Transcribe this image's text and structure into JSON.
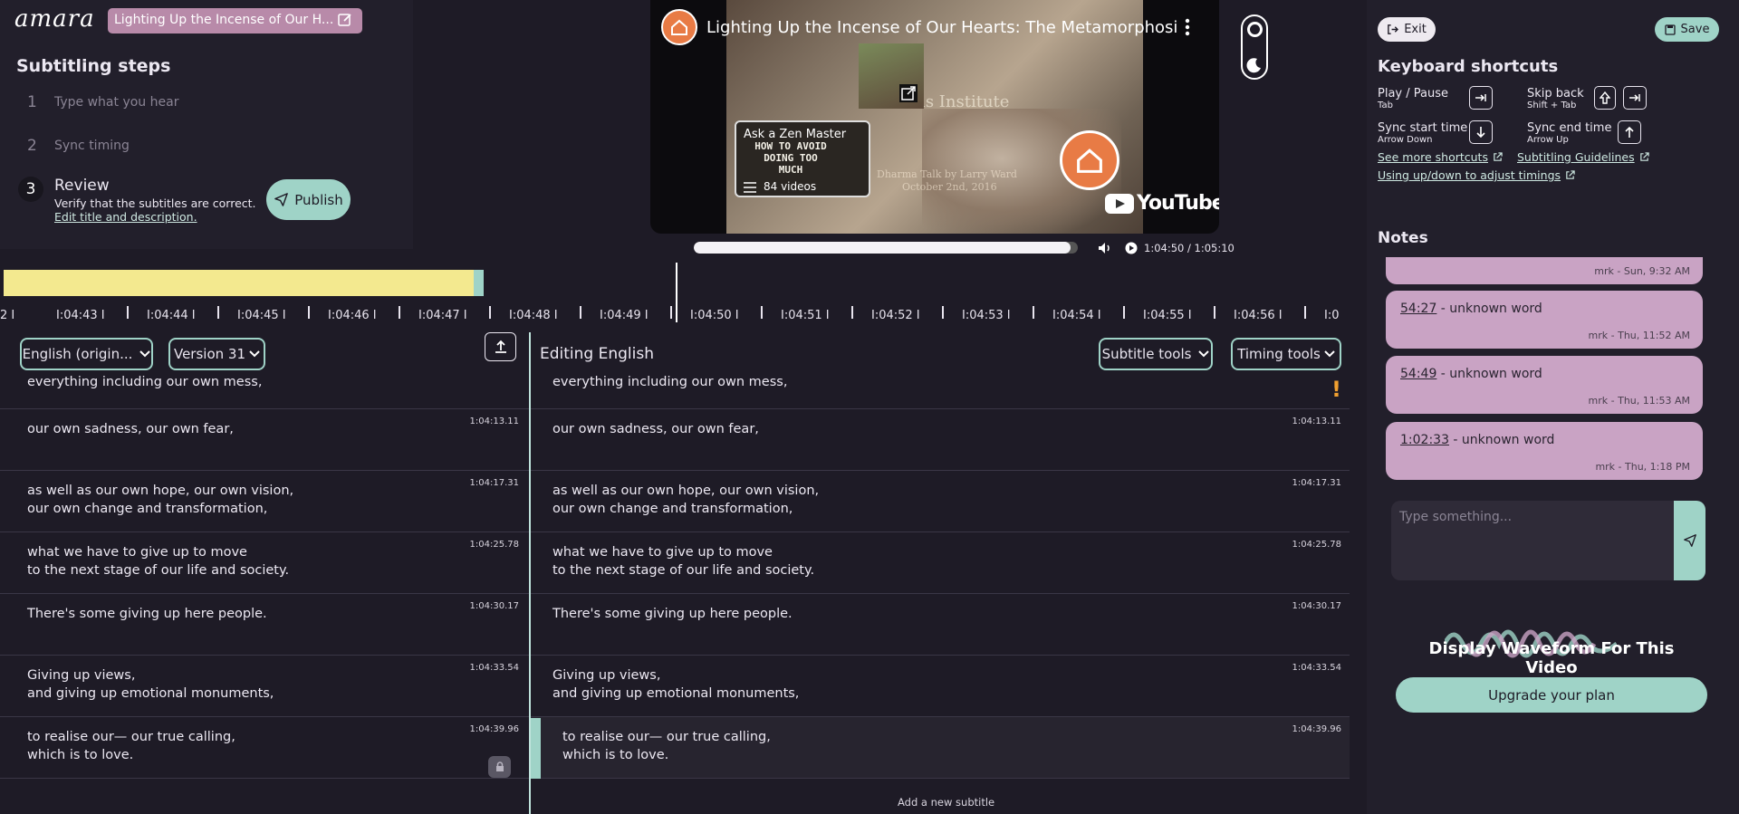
{
  "brand": {
    "logo": "amara"
  },
  "header": {
    "video_title": "Lighting Up the Incense of Our H..."
  },
  "steps": {
    "title": "Subtitling steps",
    "items": [
      {
        "num": "1",
        "label": "Type what you hear"
      },
      {
        "num": "2",
        "label": "Sync timing"
      },
      {
        "num": "3",
        "label": "Review",
        "desc": "Verify that the subtitles are correct.",
        "link": "Edit title and description."
      }
    ],
    "publish_label": "Publish"
  },
  "video": {
    "title": "Lighting Up the Incense of Our Hearts: The Metamorphosis of...",
    "card_title": "Ask a Zen Master",
    "card_thumb_text": "HOW TO AVOID DOING TOO MUCH",
    "card_count": "84 videos",
    "bg_text1": "tus Institute",
    "bg_text2": "Dharma Talk by Larry Ward",
    "bg_text3": "October 2nd, 2016",
    "youtube_label": "YouTube",
    "time": "1:04:50 / 1:05:10",
    "progress": 0.98
  },
  "timeline": {
    "ticks": [
      "2 I",
      "I:04:43 I",
      "I:04:44 I",
      "I:04:45 I",
      "I:04:46 I",
      "I:04:47 I",
      "I:04:48 I",
      "I:04:49 I",
      "I:04:50 I",
      "I:04:51 I",
      "I:04:52 I",
      "I:04:53 I",
      "I:04:54 I",
      "I:04:55 I",
      "I:04:56 I",
      "I:0"
    ]
  },
  "toolbar": {
    "language": "English (origin...",
    "version": "Version 31",
    "editing_title": "Editing English",
    "subtitle_tools": "Subtitle tools",
    "timing_tools": "Timing tools"
  },
  "subtitles": [
    {
      "text": "everything including our own mess,",
      "time": ""
    },
    {
      "text": "our own sadness, our own fear,",
      "time": "1:04:13.11"
    },
    {
      "text": "as well as our own hope, our own vision,\nour own change and transformation,",
      "time": "1:04:17.31"
    },
    {
      "text": "what we have to give up to move\nto the next stage of our life and society.",
      "time": "1:04:25.78"
    },
    {
      "text": "There's some giving up here people.",
      "time": "1:04:30.17"
    },
    {
      "text": "Giving up views,\nand giving up emotional monuments,",
      "time": "1:04:33.54"
    },
    {
      "text": "to realise our— our true calling,\nwhich is to love.",
      "time": "1:04:39.96"
    }
  ],
  "add_subtitle": "Add a new subtitle",
  "right": {
    "exit_label": "Exit",
    "save_label": "Save",
    "shortcuts_title": "Keyboard shortcuts",
    "shortcuts": [
      {
        "label": "Play / Pause",
        "key": "Tab"
      },
      {
        "label": "Skip back",
        "key": "Shift + Tab"
      },
      {
        "label": "Sync start time",
        "key": "Arrow Down"
      },
      {
        "label": "Sync end time",
        "key": "Arrow Up"
      }
    ],
    "link_more": "See more shortcuts",
    "link_guidelines": "Subtitling Guidelines",
    "link_updown": "Using up/down to adjust timings",
    "notes_title": "Notes",
    "notes": [
      {
        "time": "",
        "text": "",
        "meta": "mrk - Sun, 9:32 AM"
      },
      {
        "time": "54:27",
        "text": " - unknown word",
        "meta": "mrk - Thu, 11:52 AM"
      },
      {
        "time": "54:49",
        "text": " - unknown word",
        "meta": "mrk - Thu, 11:53 AM"
      },
      {
        "time": "1:02:33",
        "text": " - unknown word",
        "meta": "mrk - Thu, 1:18 PM"
      }
    ],
    "note_placeholder": "Type something...",
    "waveform_label": "Display Waveform For This Video",
    "upgrade_label": "Upgrade your plan"
  },
  "colors": {
    "accent": "#9fd3c7",
    "note": "#c9a3c4",
    "waveform_bar": "#f3e98f",
    "warning": "#f0a030"
  }
}
